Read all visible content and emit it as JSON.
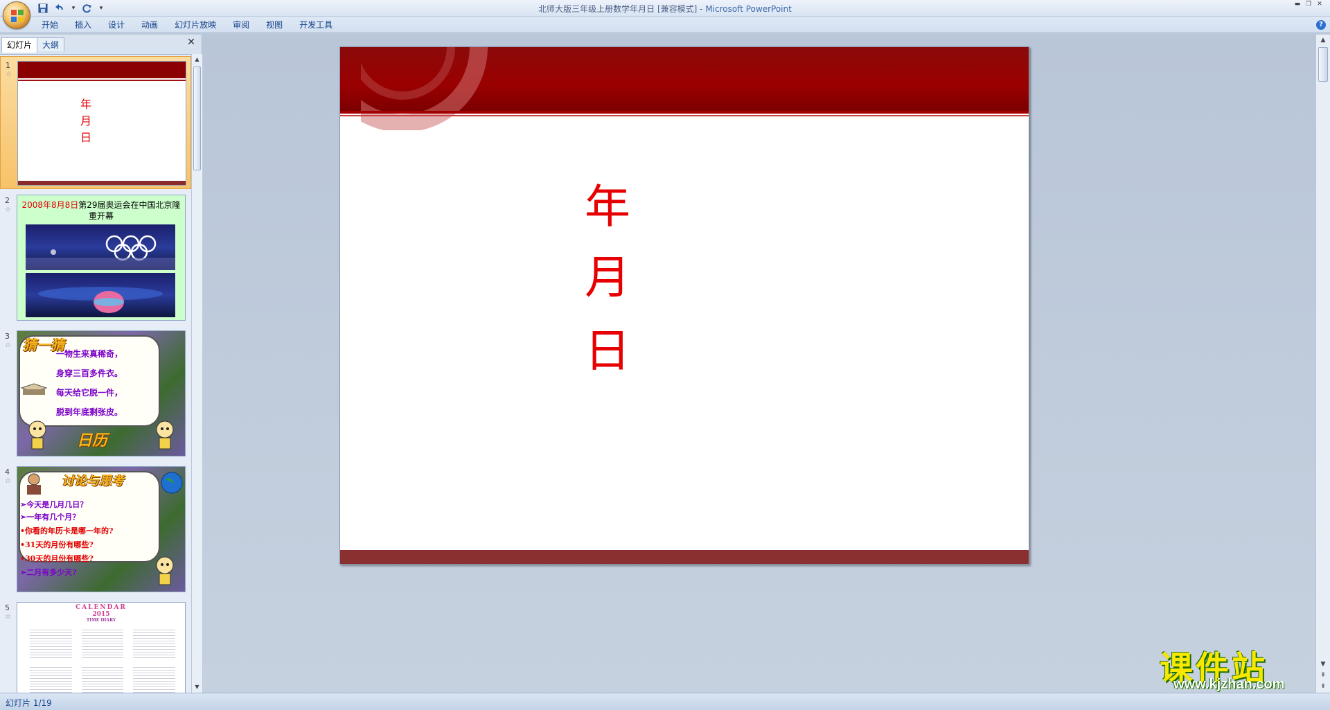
{
  "window": {
    "title_doc": "北师大版三年级上册数学年月日 [兼容模式] -",
    "title_app": "Microsoft PowerPoint"
  },
  "ribbon": {
    "tabs": [
      "开始",
      "插入",
      "设计",
      "动画",
      "幻灯片放映",
      "审阅",
      "视图",
      "开发工具"
    ]
  },
  "left_panel": {
    "tabs": [
      {
        "label": "幻灯片",
        "active": true
      },
      {
        "label": "大纲",
        "active": false
      }
    ],
    "close_glyph": "✕"
  },
  "thumbnails": [
    {
      "number": "1",
      "chars": [
        "年",
        "月",
        "日"
      ]
    },
    {
      "number": "2",
      "title_red": "2008年8月8日",
      "title_black": "第29届奥运会在中国北京隆重开幕"
    },
    {
      "number": "3",
      "wordart_top": "猜一猜",
      "wordart_bottom": "日历",
      "lines": [
        "一物生来真稀奇，",
        "身穿三百多件衣。",
        "每天给它脱一件，",
        "脱到年底剩张皮。"
      ]
    },
    {
      "number": "4",
      "wordart_top": "讨论与思考",
      "lines": [
        "➢今天是几月几日？",
        "➢一年有几个月？",
        "•你看的年历卡是哪一年的?",
        "•31天的月份有哪些?",
        "•30天的月份有哪些?",
        "➢二月有多少天?"
      ]
    },
    {
      "number": "5",
      "cal_title": "CALENDAR",
      "cal_year": "2015",
      "cal_sub": "TIME DIARY"
    }
  ],
  "slide": {
    "chars": [
      "年",
      "月",
      "日"
    ]
  },
  "status": {
    "slide_indicator": "幻灯片 1/19"
  },
  "watermark": {
    "main": "课件站",
    "url": "www.kjzhan.com"
  },
  "colors": {
    "slide_band": "#8b0000",
    "title_red": "#e60000",
    "ribbon_text": "#15428b"
  }
}
